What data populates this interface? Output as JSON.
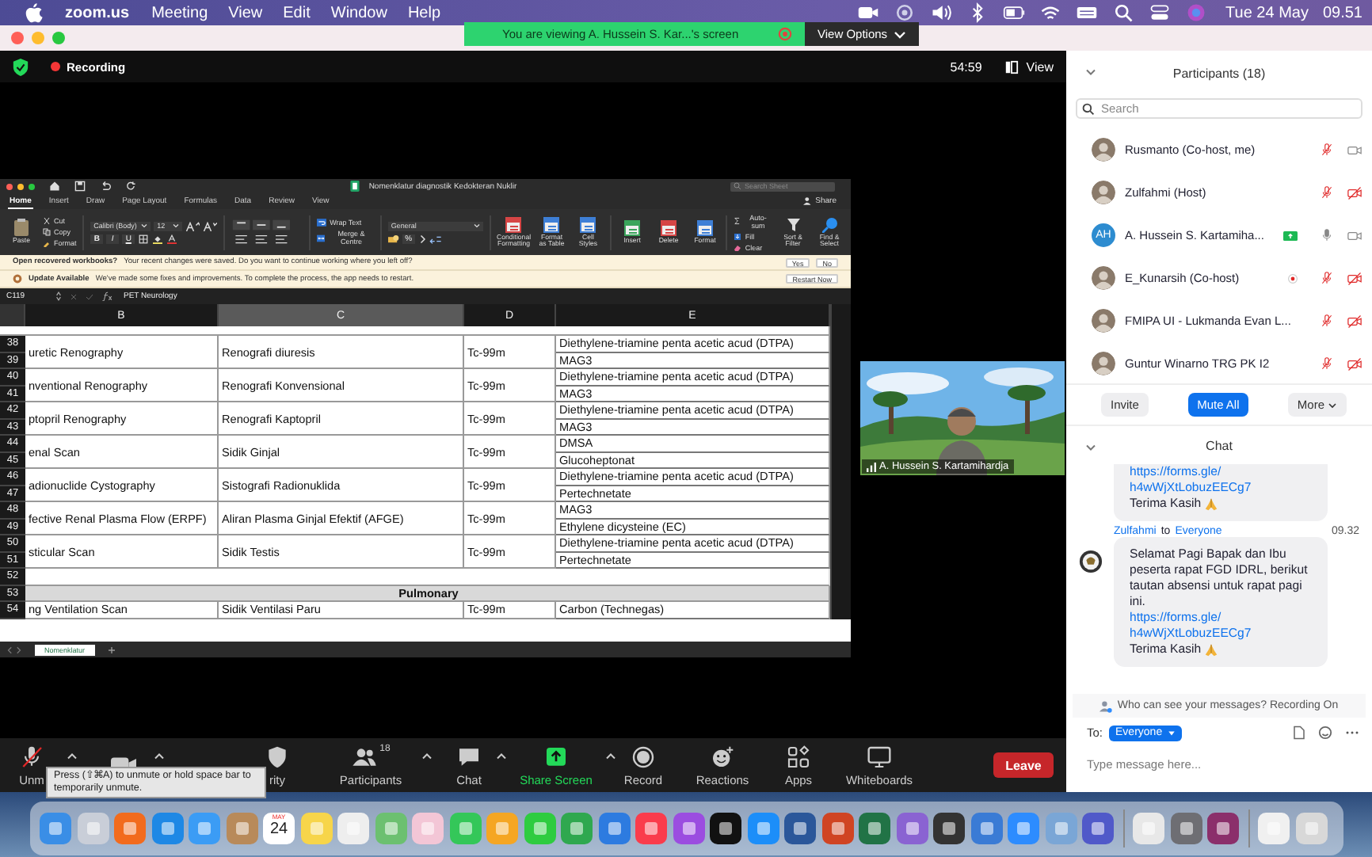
{
  "menubar": {
    "app": "zoom.us",
    "menus": [
      "Meeting",
      "View",
      "Edit",
      "Window",
      "Help"
    ],
    "date": "Tue 24 May",
    "time": "09.51"
  },
  "share_banner": {
    "text": "You are viewing A. Hussein S. Kar...'s screen",
    "button": "View Options"
  },
  "meeting_bar": {
    "recording": "Recording",
    "timer": "54:59",
    "view": "View"
  },
  "excel": {
    "title": "Nomenklatur diagnostik Kedokteran Nuklir",
    "search": {
      "placeholder": "Search Sheet"
    },
    "share": "Share",
    "tabs": [
      {
        "label": "Home",
        "selected": true
      },
      {
        "label": "Insert",
        "selected": false
      },
      {
        "label": "Draw",
        "selected": false
      },
      {
        "label": "Page Layout",
        "selected": false
      },
      {
        "label": "Formulas",
        "selected": false
      },
      {
        "label": "Data",
        "selected": false
      },
      {
        "label": "Review",
        "selected": false
      },
      {
        "label": "View",
        "selected": false
      }
    ],
    "ribbon": {
      "paste": "Paste",
      "clipboard": [
        "Cut",
        "Copy",
        "Format"
      ],
      "font": {
        "name": "Calibri (Body)",
        "size": "12",
        "styles": [
          "B",
          "I",
          "U"
        ]
      },
      "wrap": "Wrap Text",
      "merge": "Merge & Centre",
      "number": {
        "format": "General",
        "percent": "%"
      },
      "buttons": [
        {
          "kind": "conditional",
          "label": "Conditional Formatting"
        },
        {
          "kind": "table",
          "label": "Format as Table"
        },
        {
          "kind": "styles",
          "label": "Cell Styles"
        },
        {
          "kind": "insert",
          "label": "Insert"
        },
        {
          "kind": "delete",
          "label": "Delete"
        },
        {
          "kind": "format",
          "label": "Format"
        }
      ],
      "editing": [
        "Auto-sum",
        "Fill",
        "Clear"
      ],
      "tools": [
        {
          "kind": "sort",
          "label": "Sort & Filter"
        },
        {
          "kind": "find",
          "label": "Find & Select"
        }
      ]
    },
    "notices": [
      {
        "kind": "recovered",
        "title": "Open recovered workbooks?",
        "text": "Your recent changes were saved. Do you want to continue working where you left off?",
        "buttons": [
          "Yes",
          "No"
        ]
      },
      {
        "kind": "update",
        "title": "Update Available",
        "text": "We've made some fixes and improvements. To complete the process, the app needs to restart.",
        "buttons": [
          "Restart Now"
        ]
      }
    ],
    "formula_bar": {
      "cell": "C119",
      "value": "PET Neurology"
    },
    "columns": [
      "B",
      "C",
      "D",
      "E"
    ],
    "rows": [
      {
        "kind": "pair",
        "numbers": [
          "38",
          "39"
        ],
        "b": "uretic Renography",
        "c": "Renografi diuresis",
        "d": "Tc-99m",
        "e": [
          "Diethylene-triamine penta acetic acud (DTPA)",
          "MAG3"
        ]
      },
      {
        "kind": "pair",
        "numbers": [
          "40",
          "41"
        ],
        "b": "nventional Renography",
        "c": "Renografi Konvensional",
        "d": "Tc-99m",
        "e": [
          "Diethylene-triamine penta acetic acud (DTPA)",
          "MAG3"
        ]
      },
      {
        "kind": "pair",
        "numbers": [
          "42",
          "43"
        ],
        "b": "ptopril Renography",
        "c": "Renografi Kaptopril",
        "d": "Tc-99m",
        "e": [
          "Diethylene-triamine penta acetic acud (DTPA)",
          "MAG3"
        ]
      },
      {
        "kind": "pair",
        "numbers": [
          "44",
          "45"
        ],
        "b": "enal Scan",
        "c": "Sidik Ginjal",
        "d": "Tc-99m",
        "e": [
          "DMSA",
          "Glucoheptonat"
        ]
      },
      {
        "kind": "pair",
        "numbers": [
          "46",
          "47"
        ],
        "b": "adionuclide Cystography",
        "c": "Sistografi Radionuklida",
        "d": "Tc-99m",
        "e": [
          "Diethylene-triamine penta acetic acud (DTPA)",
          "Pertechnetate"
        ]
      },
      {
        "kind": "pair",
        "numbers": [
          "48",
          "49"
        ],
        "b": "fective Renal Plasma Flow (ERPF)",
        "c": "Aliran Plasma Ginjal Efektif (AFGE)",
        "d": "Tc-99m",
        "e": [
          "MAG3",
          "Ethylene dicysteine (EC)"
        ]
      },
      {
        "kind": "pair",
        "numbers": [
          "50",
          "51"
        ],
        "b": "sticular Scan",
        "c": "Sidik Testis",
        "d": "Tc-99m",
        "e": [
          "Diethylene-triamine penta acetic acud (DTPA)",
          "Pertechnetate"
        ]
      },
      {
        "kind": "blank",
        "numbers": [
          "52"
        ]
      },
      {
        "kind": "section",
        "numbers": [
          "53"
        ],
        "title": "Pulmonary"
      },
      {
        "kind": "pair",
        "numbers": [
          "54"
        ],
        "b": "ng Ventilation Scan",
        "c": "Sidik Ventilasi Paru",
        "d": "Tc-99m",
        "e": [
          "Carbon (Technegas)"
        ]
      }
    ],
    "sheet_tabs": [
      {
        "label": "Nomenklatur",
        "selected": true
      }
    ]
  },
  "video_tile": {
    "name": "A. Hussein S. Kartamihardja"
  },
  "participants": {
    "title": "Participants (18)",
    "search": {
      "placeholder": "Search"
    },
    "list": [
      {
        "name": "Rusmanto (Co-host, me)",
        "muted": true,
        "video_off": false,
        "sharing": false,
        "recording": false
      },
      {
        "name": "Zulfahmi (Host)",
        "muted": true,
        "video_off": true,
        "sharing": false,
        "recording": false
      },
      {
        "name": "A. Hussein S. Kartamiha...",
        "initials": "AH",
        "color": "#2d8cd0",
        "muted": false,
        "video_off": false,
        "sharing": true,
        "recording": false
      },
      {
        "name": "E_Kunarsih (Co-host)",
        "muted": true,
        "video_off": true,
        "sharing": false,
        "recording": true
      },
      {
        "name": "FMIPA UI - Lukmanda Evan L...",
        "muted": true,
        "video_off": true,
        "sharing": false,
        "recording": false
      },
      {
        "name": "Guntur Winarno TRG PK I2",
        "muted": true,
        "video_off": true,
        "sharing": false,
        "recording": false
      }
    ],
    "buttons": [
      {
        "kind": "plain",
        "label": "Invite"
      },
      {
        "kind": "primary",
        "label": "Mute All"
      },
      {
        "kind": "menu",
        "label": "More"
      }
    ]
  },
  "chat": {
    "title": "Chat",
    "messages": [
      {
        "link": "https://forms.gle/h4wWjXtLobuzEECg7",
        "closing": "Terima Kasih"
      },
      {
        "sender": "Zulfahmi",
        "to_label": "to",
        "to": "Everyone",
        "time": "09.32",
        "text": "Selamat Pagi Bapak dan Ibu peserta rapat FGD IDRL, berikut tautan absensi untuk rapat pagi ini.",
        "link": "https://forms.gle/h4wWjXtLobuzEECg7",
        "closing": "Terima Kasih"
      }
    ],
    "privacy": "Who can see your messages? Recording On",
    "to_label": "To:",
    "recipient": "Everyone",
    "input": {
      "placeholder": "Type message here..."
    }
  },
  "toolbar": {
    "items": [
      {
        "kind": "mic",
        "label": "Unm",
        "muted": true,
        "caret": true
      },
      {
        "kind": "video",
        "caret": true
      },
      {
        "kind": "security",
        "label": "rity",
        "caret": false
      },
      {
        "kind": "participants",
        "label": "Participants",
        "count": "18",
        "caret": true
      },
      {
        "kind": "chat",
        "label": "Chat",
        "caret": true
      },
      {
        "kind": "share",
        "label": "Share Screen",
        "caret": true
      },
      {
        "kind": "record",
        "label": "Record",
        "caret": false
      },
      {
        "kind": "reactions",
        "label": "Reactions",
        "caret": false
      },
      {
        "kind": "apps",
        "label": "Apps",
        "caret": false
      },
      {
        "kind": "whiteboards",
        "label": "Whiteboards",
        "caret": false
      }
    ],
    "leave": "Leave",
    "tooltip": "Press  (⇧⌘A) to unmute or hold space bar to temporarily unmute."
  },
  "dock": [
    {
      "kind": "app",
      "color": "#3a8ee6"
    },
    {
      "kind": "app",
      "color": "#c9ced8"
    },
    {
      "kind": "app",
      "color": "#f26b1d"
    },
    {
      "kind": "app",
      "color": "#1e88e5"
    },
    {
      "kind": "app",
      "color": "#3b9cf5"
    },
    {
      "kind": "app",
      "color": "#b88a5a"
    },
    {
      "kind": "calendar",
      "month": "MAY",
      "day": "24"
    },
    {
      "kind": "app",
      "color": "#f7d54a"
    },
    {
      "kind": "app",
      "color": "#eeeeee"
    },
    {
      "kind": "app",
      "color": "#6cc070"
    },
    {
      "kind": "app",
      "color": "#f3c6d6"
    },
    {
      "kind": "app",
      "color": "#34c759"
    },
    {
      "kind": "app",
      "color": "#f5a623"
    },
    {
      "kind": "app",
      "color": "#2ecc40"
    },
    {
      "kind": "app",
      "color": "#2fa84f"
    },
    {
      "kind": "app",
      "color": "#2d7be0"
    },
    {
      "kind": "app",
      "color": "#fa3c4c"
    },
    {
      "kind": "app",
      "color": "#9b4de0"
    },
    {
      "kind": "app",
      "color": "#111111"
    },
    {
      "kind": "app",
      "color": "#1c8ef9"
    },
    {
      "kind": "app",
      "color": "#2b579a"
    },
    {
      "kind": "app",
      "color": "#d04423"
    },
    {
      "kind": "app",
      "color": "#217346"
    },
    {
      "kind": "app",
      "color": "#8a63d2"
    },
    {
      "kind": "app",
      "color": "#333333"
    },
    {
      "kind": "app",
      "color": "#3a7bd5"
    },
    {
      "kind": "app",
      "color": "#2d8cff"
    },
    {
      "kind": "app",
      "color": "#7aa6d6"
    },
    {
      "kind": "app",
      "color": "#5059c9"
    },
    {
      "kind": "separator"
    },
    {
      "kind": "app",
      "color": "#e8e8e8"
    },
    {
      "kind": "app",
      "color": "#6e6e73"
    },
    {
      "kind": "app",
      "color": "#8b2f6b"
    },
    {
      "kind": "separator"
    },
    {
      "kind": "app",
      "color": "#f0f0f0"
    },
    {
      "kind": "app",
      "color": "#d8d8d8"
    }
  ]
}
